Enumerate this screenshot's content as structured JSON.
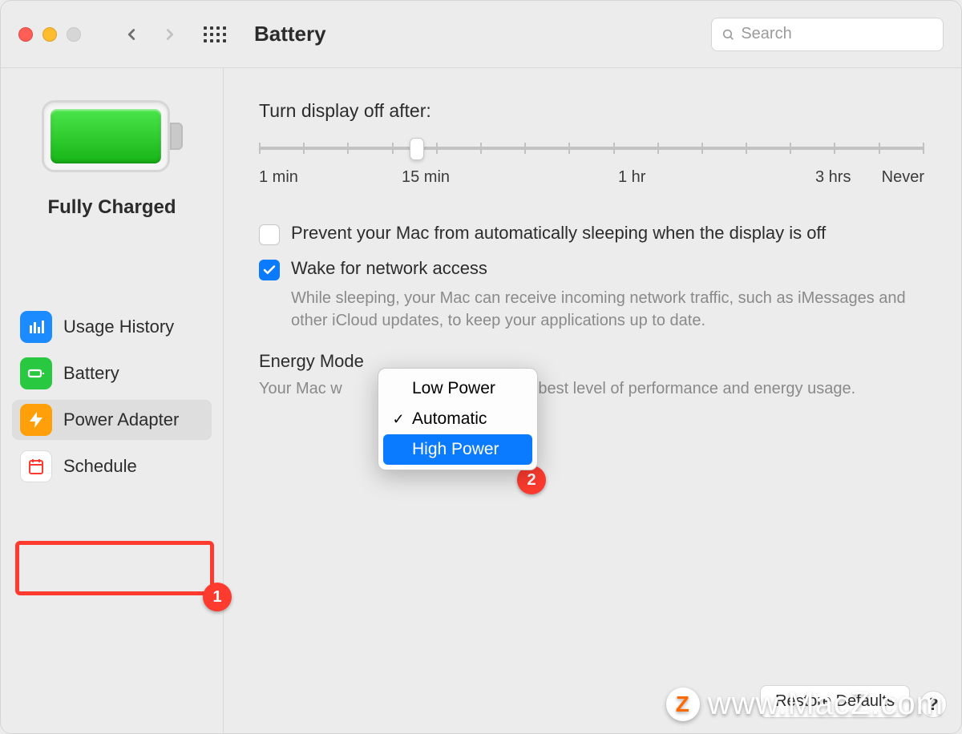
{
  "window": {
    "title": "Battery",
    "search_placeholder": "Search"
  },
  "sidebar": {
    "status": "Fully Charged",
    "items": [
      {
        "label": "Usage History"
      },
      {
        "label": "Battery"
      },
      {
        "label": "Power Adapter"
      },
      {
        "label": "Schedule"
      }
    ],
    "selected_index": 2
  },
  "main": {
    "slider_title": "Turn display off after:",
    "slider_labels": [
      "1 min",
      "15 min",
      "1 hr",
      "3 hrs",
      "Never"
    ],
    "prevent_sleep_label": "Prevent your Mac from automatically sleeping when the display is off",
    "prevent_sleep_checked": false,
    "wake_network_label": "Wake for network access",
    "wake_network_checked": true,
    "wake_network_desc": "While sleeping, your Mac can receive incoming network traffic, such as iMessages and other iCloud updates, to keep your applications up to date.",
    "energy_mode_label": "Energy Mode",
    "energy_mode_desc_prefix": "Your Mac w",
    "energy_mode_desc_suffix": "se the best level of performance and energy usage.",
    "dropdown": {
      "options": [
        "Low Power",
        "Automatic",
        "High Power"
      ],
      "selected": "Automatic",
      "highlighted": "High Power"
    },
    "restore_label": "Restore Defaults",
    "help_label": "?"
  },
  "annotations": {
    "badge1": "1",
    "badge2": "2"
  },
  "watermark": {
    "z": "Z",
    "text": "www.MacZ.com"
  },
  "colors": {
    "accent": "#0a7bff",
    "annotation": "#ff3b2f"
  }
}
